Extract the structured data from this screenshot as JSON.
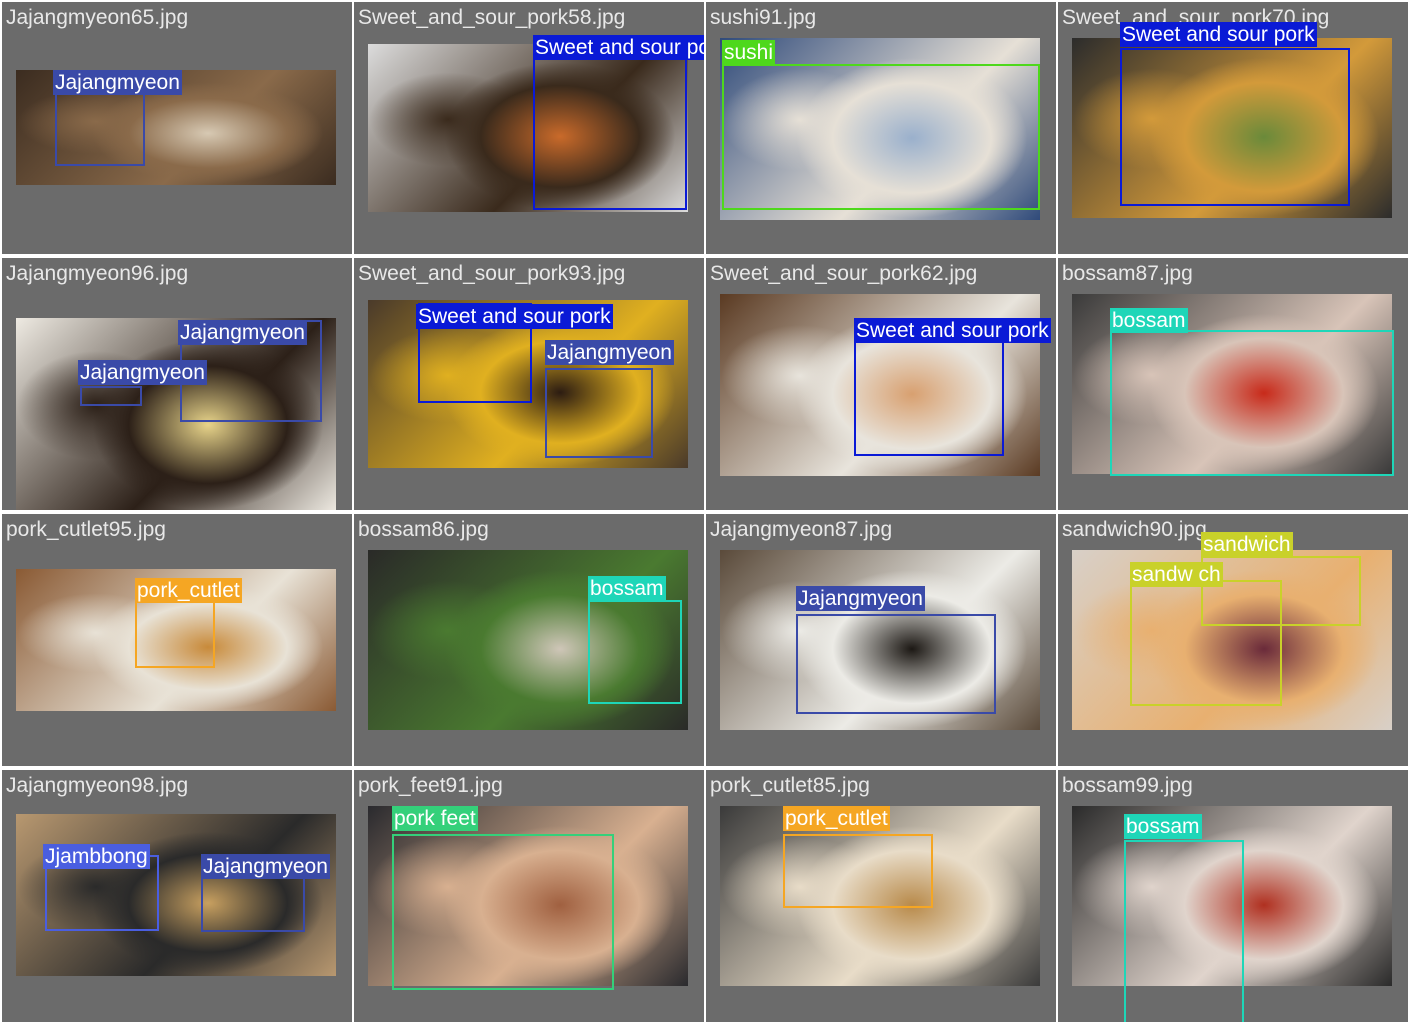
{
  "colors": {
    "cell_bg": "#6b6b6b",
    "filename_text": "#e8e8e8",
    "Jajangmyeon": "#3a4aa8",
    "Sweet and sour pork": "#0a1ad6",
    "sushi": "#4ed81c",
    "bossam": "#1ed6b8",
    "pork_cutlet": "#f5a623",
    "sandwich": "#c9d12a",
    "pork feet": "#34d07a",
    "Jjambbong": "#4a5ee0"
  },
  "cells": [
    {
      "file": "Jajangmyeon65.jpg",
      "bg": [
        "#3b2c20",
        "#8a6a4a",
        "#d7c9b3"
      ],
      "dets": [
        {
          "label": "Jajangmyeon",
          "cls": "Jajangmyeon"
        }
      ]
    },
    {
      "file": "Sweet_and_sour_pork58.jpg",
      "bg": [
        "#dcdcdc",
        "#3a2a1c",
        "#c96a2a"
      ],
      "dets": [
        {
          "label": "Sweet and sour pork",
          "cls": "Sweet and sour pork"
        }
      ]
    },
    {
      "file": "sushi91.jpg",
      "bg": [
        "#2f4a7a",
        "#e6e0d6",
        "#9ab0cc"
      ],
      "dets": [
        {
          "label": "sushi",
          "cls": "sushi"
        }
      ]
    },
    {
      "file": "Sweet_and_sour_pork70.jpg",
      "bg": [
        "#2c2c2c",
        "#d39a3a",
        "#6a8a3a"
      ],
      "dets": [
        {
          "label": "Sweet and sour pork",
          "cls": "Sweet and sour pork"
        }
      ]
    },
    {
      "file": "Jajangmyeon96.jpg",
      "bg": [
        "#eeeae2",
        "#2c2018",
        "#e8d48a"
      ],
      "dets": [
        {
          "label": "Jajangmyeon",
          "cls": "Jajangmyeon"
        },
        {
          "label": "Jajangmyeon",
          "cls": "Jajangmyeon"
        }
      ]
    },
    {
      "file": "Sweet_and_sour_pork93.jpg",
      "bg": [
        "#4a3a2a",
        "#e0b020",
        "#2c1c12"
      ],
      "dets": [
        {
          "label": "Sweet and sour pork",
          "cls": "Sweet and sour pork"
        },
        {
          "label": "Jajangmyeon",
          "cls": "Jajangmyeon"
        }
      ]
    },
    {
      "file": "Sweet_and_sour_pork62.jpg",
      "bg": [
        "#5a3a22",
        "#e8e4dc",
        "#d8a070"
      ],
      "dets": [
        {
          "label": "Sweet and sour pork",
          "cls": "Sweet and sour pork"
        }
      ]
    },
    {
      "file": "bossam87.jpg",
      "bg": [
        "#3a3a3a",
        "#d8c4b8",
        "#c82a1a"
      ],
      "dets": [
        {
          "label": "bossam",
          "cls": "bossam"
        }
      ]
    },
    {
      "file": "pork_cutlet95.jpg",
      "bg": [
        "#8a5a34",
        "#e8e2d6",
        "#c88a3a"
      ],
      "dets": [
        {
          "label": "pork_cutlet",
          "cls": "pork_cutlet"
        }
      ]
    },
    {
      "file": "bossam86.jpg",
      "bg": [
        "#2a2a28",
        "#4a7a30",
        "#cfc6b8"
      ],
      "dets": [
        {
          "label": "bossam",
          "cls": "bossam"
        }
      ]
    },
    {
      "file": "Jajangmyeon87.jpg",
      "bg": [
        "#5a4a3a",
        "#ecebe6",
        "#1c1814"
      ],
      "dets": [
        {
          "label": "Jajangmyeon",
          "cls": "Jajangmyeon"
        }
      ]
    },
    {
      "file": "sandwich90.jpg",
      "bg": [
        "#d8d0c8",
        "#e8b070",
        "#6a2a3a"
      ],
      "dets": [
        {
          "label": "sandwich",
          "cls": "sandwich"
        },
        {
          "label": "sandw ch",
          "cls": "sandwich"
        }
      ]
    },
    {
      "file": "Jajangmyeon98.jpg",
      "bg": [
        "#b89870",
        "#2a2a2a",
        "#c8a060"
      ],
      "dets": [
        {
          "label": "Jjambbong",
          "cls": "Jjambbong"
        },
        {
          "label": "Jajangmyeon",
          "cls": "Jajangmyeon"
        }
      ]
    },
    {
      "file": "pork_feet91.jpg",
      "bg": [
        "#2a2a2e",
        "#d8b090",
        "#a06040"
      ],
      "dets": [
        {
          "label": "pork feet",
          "cls": "pork feet"
        }
      ]
    },
    {
      "file": "pork_cutlet85.jpg",
      "bg": [
        "#3a3a3a",
        "#e8dcc8",
        "#b88a4a"
      ],
      "dets": [
        {
          "label": "pork_cutlet",
          "cls": "pork_cutlet"
        }
      ]
    },
    {
      "file": "bossam99.jpg",
      "bg": [
        "#2a2a2a",
        "#e0d4cc",
        "#b03020"
      ],
      "dets": [
        {
          "label": "bossam",
          "cls": "bossam"
        }
      ]
    }
  ]
}
